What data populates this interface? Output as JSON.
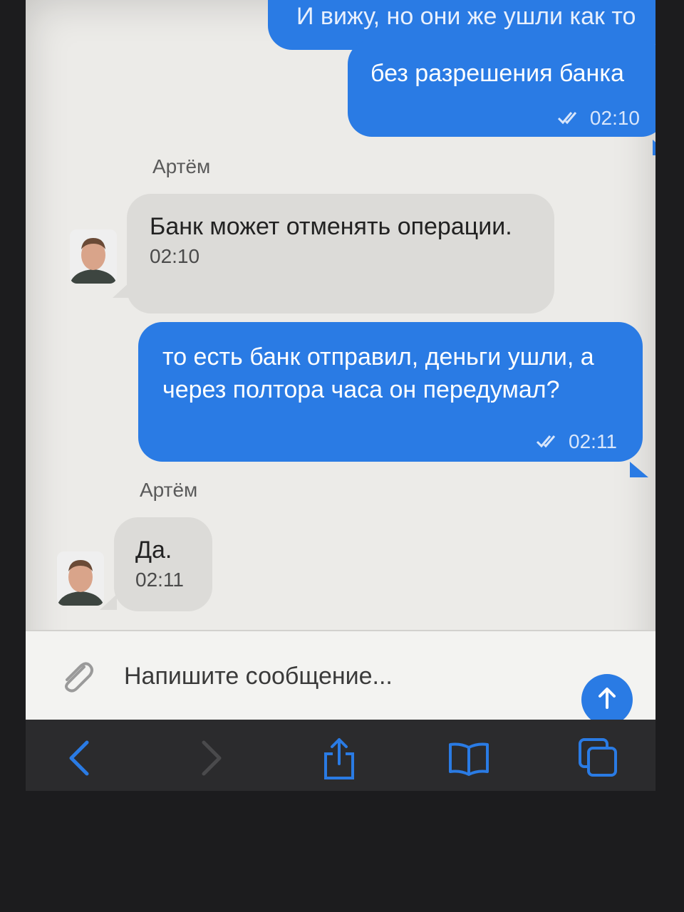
{
  "messages": [
    {
      "text": "И вижу, но они же ушли как то",
      "time": ""
    },
    {
      "text": "без разрешения банка",
      "time": "02:10"
    },
    {
      "sender": "Артём",
      "text": "Банк может отменять операции.",
      "time": "02:10"
    },
    {
      "text_line1": "то есть банк отправил, деньги ушли, а",
      "text_line2": "через полтора часа он передумал?",
      "time": "02:11"
    },
    {
      "sender": "Артём",
      "text": "Да.",
      "time": "02:11"
    }
  ],
  "composer": {
    "placeholder": "Напишите сообщение..."
  },
  "icons": {
    "attach": "paperclip-icon",
    "send": "arrow-up-icon",
    "read_receipt": "double-check-icon",
    "toolbar": [
      "back-icon",
      "forward-icon",
      "share-icon",
      "bookmarks-icon",
      "tabs-icon"
    ]
  },
  "colors": {
    "outgoing": "#2a7be4",
    "incoming": "#dcdbd8",
    "toolbar_accent": "#2a7be4"
  }
}
